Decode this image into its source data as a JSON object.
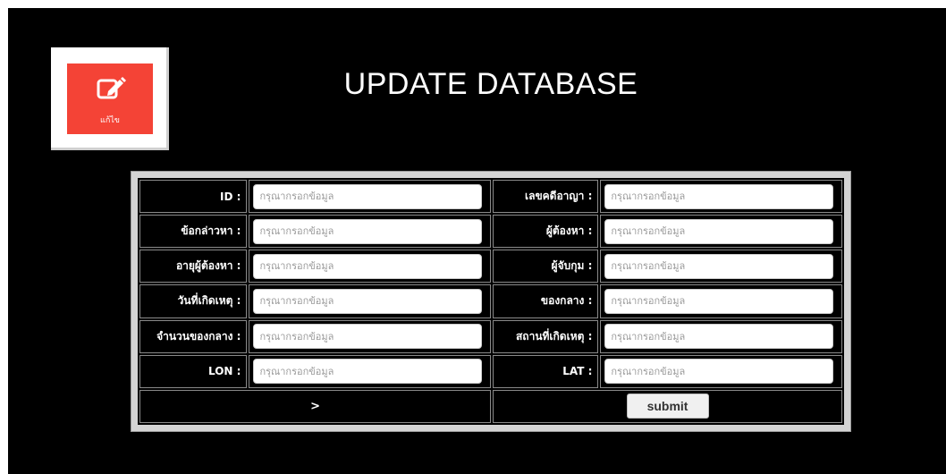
{
  "page": {
    "title": "UPDATE DATABASE"
  },
  "edit_tile": {
    "icon": "edit-icon",
    "label": "แก้ไข",
    "color": "#f44336"
  },
  "form": {
    "placeholder": "กรุณากรอกข้อมูล",
    "rows": [
      {
        "left": {
          "label": "ID :"
        },
        "right": {
          "label": "เลขคดีอาญา :"
        }
      },
      {
        "left": {
          "label": "ข้อกล่าวหา :"
        },
        "right": {
          "label": "ผู้ต้องหา :"
        }
      },
      {
        "left": {
          "label": "อายุผู้ต้องหา :"
        },
        "right": {
          "label": "ผู้จับกุม :"
        }
      },
      {
        "left": {
          "label": "วันที่เกิดเหตุ :"
        },
        "right": {
          "label": "ของกลาง :"
        }
      },
      {
        "left": {
          "label": "จำนวนของกลาง :"
        },
        "right": {
          "label": "สถานที่เกิดเหตุ :"
        }
      },
      {
        "left": {
          "label": "LON :"
        },
        "right": {
          "label": "LAT :"
        }
      }
    ],
    "footer_arrow": ">",
    "submit_label": "submit"
  }
}
